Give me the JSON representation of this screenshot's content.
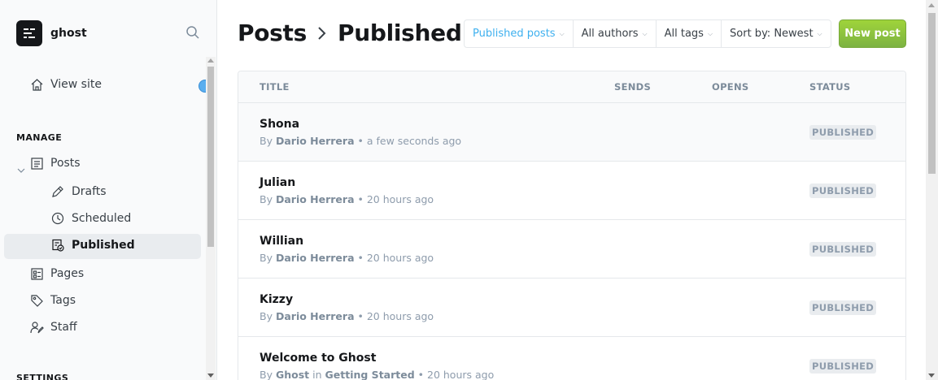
{
  "sidebar": {
    "brand": "ghost",
    "view_site": "View site",
    "manage_heading": "MANAGE",
    "posts": "Posts",
    "drafts": "Drafts",
    "scheduled": "Scheduled",
    "published": "Published",
    "pages": "Pages",
    "tags": "Tags",
    "staff": "Staff",
    "settings_heading": "SETTINGS"
  },
  "header": {
    "crumb_root": "Posts",
    "crumb_current": "Published",
    "new_post": "New post"
  },
  "filters": [
    {
      "label": "Published posts",
      "active": true
    },
    {
      "label": "All authors",
      "active": false
    },
    {
      "label": "All tags",
      "active": false
    },
    {
      "label": "Sort by: Newest",
      "active": false
    }
  ],
  "table": {
    "columns": [
      "TITLE",
      "SENDS",
      "OPENS",
      "STATUS"
    ],
    "rows": [
      {
        "title": "Shona",
        "by": "By",
        "author": "Dario Herrera",
        "in": "",
        "tag": "",
        "time": "a few seconds ago",
        "status": "PUBLISHED"
      },
      {
        "title": "Julian",
        "by": "By",
        "author": "Dario Herrera",
        "in": "",
        "tag": "",
        "time": "20 hours ago",
        "status": "PUBLISHED"
      },
      {
        "title": "Willian",
        "by": "By",
        "author": "Dario Herrera",
        "in": "",
        "tag": "",
        "time": "20 hours ago",
        "status": "PUBLISHED"
      },
      {
        "title": "Kizzy",
        "by": "By",
        "author": "Dario Herrera",
        "in": "",
        "tag": "",
        "time": "20 hours ago",
        "status": "PUBLISHED"
      },
      {
        "title": "Welcome to Ghost",
        "by": "By",
        "author": "Ghost",
        "in": "in",
        "tag": "Getting Started",
        "time": "20 hours ago",
        "status": "PUBLISHED"
      }
    ]
  },
  "colors": {
    "accent": "#3eb0ef",
    "primary_button": "#8cc63f",
    "sidebar_bg": "#f9fafb"
  }
}
